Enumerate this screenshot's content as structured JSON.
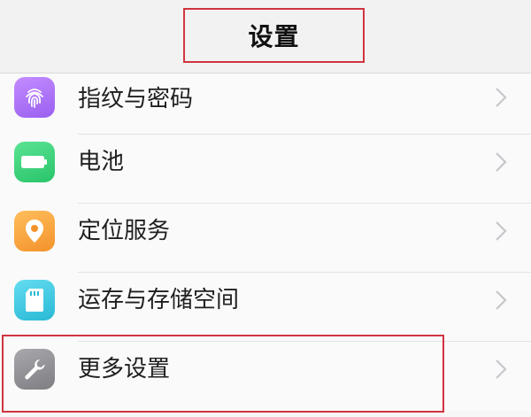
{
  "header": {
    "title": "设置"
  },
  "items": [
    {
      "label": "指纹与密码",
      "icon": "fingerprint-icon",
      "color": "#a66cf2"
    },
    {
      "label": "电池",
      "icon": "battery-icon",
      "color": "#3ad17a"
    },
    {
      "label": "定位服务",
      "icon": "location-pin-icon",
      "color": "#f7a13a"
    },
    {
      "label": "运存与存储空间",
      "icon": "storage-card-icon",
      "color": "#3fc7e0"
    },
    {
      "label": "更多设置",
      "icon": "wrench-icon",
      "color": "#8e8e93"
    }
  ],
  "colors": {
    "highlight": "#d0343f",
    "chevron": "#c7c7cc"
  }
}
